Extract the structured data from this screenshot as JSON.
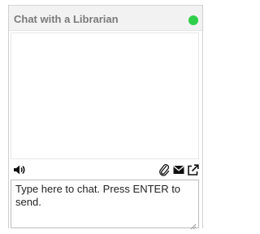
{
  "header": {
    "title": "Chat with a Librarian",
    "status_color": "#2fcf4a"
  },
  "messages": [],
  "toolbar": {
    "left": [
      "speaker-icon"
    ],
    "right": [
      "paperclip-icon",
      "envelope-icon",
      "popout-icon"
    ]
  },
  "input": {
    "placeholder": "Type here to chat. Press ENTER to send.",
    "value": ""
  }
}
